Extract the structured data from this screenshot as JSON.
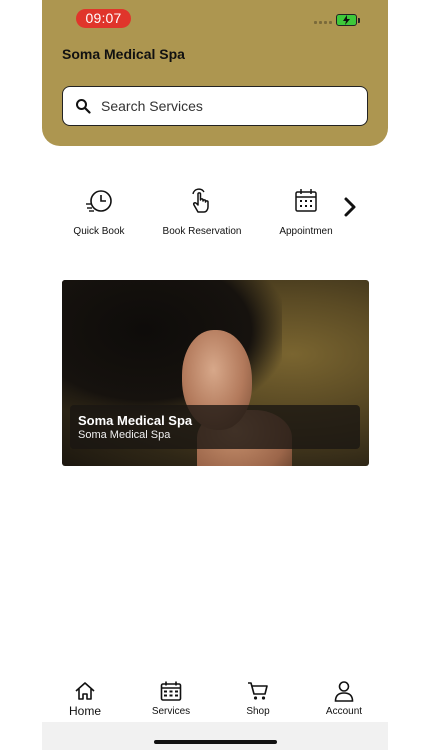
{
  "status_bar": {
    "time": "09:07"
  },
  "header": {
    "app_title": "Soma Medical Spa",
    "search_placeholder": "Search Services"
  },
  "quick_actions": [
    {
      "label": "Quick Book",
      "icon": "clock-speed-icon"
    },
    {
      "label": "Book Reservation",
      "icon": "tap-hand-icon"
    },
    {
      "label": "Appointmen",
      "icon": "calendar-icon"
    }
  ],
  "featured_card": {
    "title": "Soma Medical Spa",
    "subtitle": "Soma Medical Spa"
  },
  "tabbar": {
    "items": [
      {
        "label": "Home",
        "icon": "home-icon"
      },
      {
        "label": "Services",
        "icon": "calendar-icon"
      },
      {
        "label": "Shop",
        "icon": "cart-icon"
      },
      {
        "label": "Account",
        "icon": "person-icon"
      }
    ]
  },
  "colors": {
    "header": "#ad9650",
    "time_pill": "#e0352b",
    "battery": "#3ec83a"
  }
}
